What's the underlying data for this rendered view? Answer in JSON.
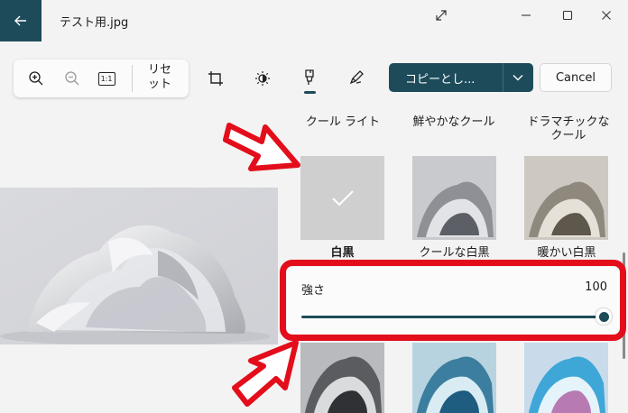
{
  "titlebar": {
    "filename": "テスト用.jpg"
  },
  "toolbar": {
    "reset_label": "リセット",
    "fit_label": "1:1",
    "copy_label": "コピーとし...",
    "cancel_label": "Cancel"
  },
  "filters": {
    "row1_labels": [
      "クール ライト",
      "鮮やかなクール",
      "ドラマチックなクール"
    ],
    "row2_labels": [
      "白黒",
      "クールな白黒",
      "暖かい白黒"
    ]
  },
  "strength": {
    "label": "強さ",
    "value": "100",
    "level": 1.0
  },
  "colors": {
    "accent": "#1d4b5a",
    "annotation": "#e30d1b"
  }
}
